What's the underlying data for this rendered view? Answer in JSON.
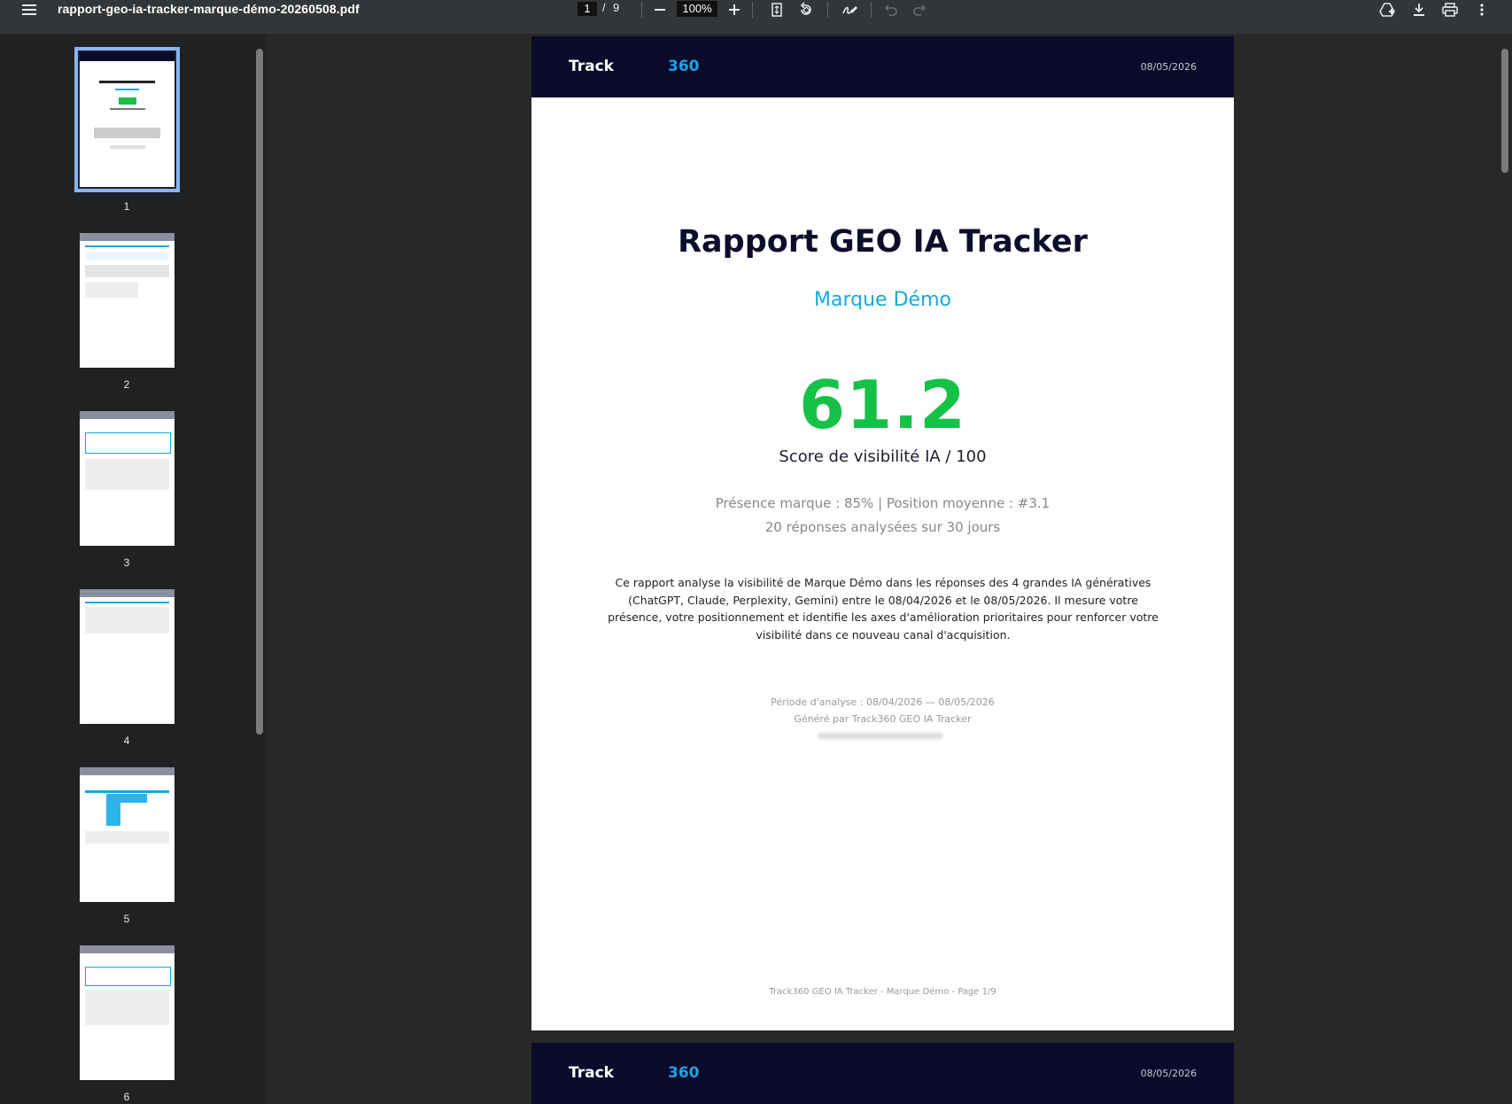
{
  "toolbar": {
    "file_name": "rapport-geo-ia-tracker-marque-démo-20260508.pdf",
    "current_page": "1",
    "separator": "/",
    "total_pages": "9",
    "zoom": "100%",
    "icons": [
      "menu-icon",
      "zoom-out-icon",
      "zoom-in-icon",
      "fit-page-icon",
      "rotate-icon",
      "annotate-icon",
      "undo-icon",
      "redo-icon",
      "add-to-drive-icon",
      "download-icon",
      "print-icon",
      "more-options-icon"
    ]
  },
  "thumbnails": [
    {
      "num": "1",
      "selected": true
    },
    {
      "num": "2",
      "selected": false
    },
    {
      "num": "3",
      "selected": false
    },
    {
      "num": "4",
      "selected": false
    },
    {
      "num": "5",
      "selected": false
    },
    {
      "num": "6",
      "selected": false
    }
  ],
  "page1": {
    "logo_part1": "Track",
    "logo_part2": "360",
    "date": "08/05/2026",
    "title": "Rapport GEO IA Tracker",
    "brand": "Marque Démo",
    "score": "61.2",
    "score_label": "Score de visibilité IA / 100",
    "stats_line1": "Présence marque : 85%  |  Position moyenne : #3.1",
    "stats_line2": "20 réponses analysées sur 30 jours",
    "description": "Ce rapport analyse la visibilité de Marque Démo dans les réponses des 4 grandes IA génératives (ChatGPT, Claude, Perplexity, Gemini) entre le 08/04/2026 et le 08/05/2026. Il mesure votre présence, votre positionnement et identifie les axes d'amélioration prioritaires pour renforcer votre visibilité dans ce nouveau canal d'acquisition.",
    "period": "Période d'analyse : 08/04/2026 — 08/05/2026",
    "generated": "Généré par Track360 GEO IA Tracker",
    "footer": "Track360 GEO IA Tracker - Marque Démo - Page 1/9"
  },
  "page2": {
    "logo_part1": "Track",
    "logo_part2": "360",
    "date": "08/05/2026"
  },
  "colors": {
    "header_bg": "#0a0a2a",
    "accent_blue": "#17a8e0",
    "score_green": "#15c247",
    "toolbar_bg": "#333638"
  }
}
